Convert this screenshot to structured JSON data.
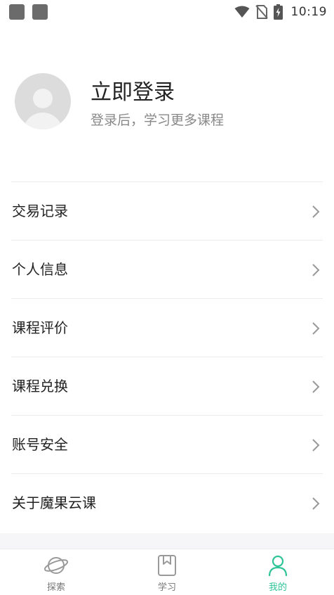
{
  "status_bar": {
    "time": "10:19",
    "icons": [
      "notification-square-icon",
      "notification-square-icon",
      "wifi-icon",
      "no-sim-icon",
      "battery-charging-icon"
    ]
  },
  "profile": {
    "title": "立即登录",
    "subtitle": "登录后，学习更多课程",
    "avatar_icon": "default-avatar-icon"
  },
  "menu": {
    "items": [
      {
        "label": "交易记录",
        "name": "menu-item-transactions"
      },
      {
        "label": "个人信息",
        "name": "menu-item-personal-info"
      },
      {
        "label": "课程评价",
        "name": "menu-item-course-reviews"
      },
      {
        "label": "课程兑换",
        "name": "menu-item-course-redeem"
      },
      {
        "label": "账号安全",
        "name": "menu-item-account-security"
      },
      {
        "label": "关于魔果云课",
        "name": "menu-item-about"
      }
    ]
  },
  "tabbar": {
    "tabs": [
      {
        "label": "探索",
        "icon": "planet-icon",
        "active": false
      },
      {
        "label": "学习",
        "icon": "book-icon",
        "active": false
      },
      {
        "label": "我的",
        "icon": "person-icon",
        "active": true
      }
    ]
  },
  "colors": {
    "accent": "#2fc497",
    "text_primary": "#222222",
    "text_secondary": "#888888",
    "divider": "#ececec",
    "avatar_bg": "#dcdcdc"
  }
}
